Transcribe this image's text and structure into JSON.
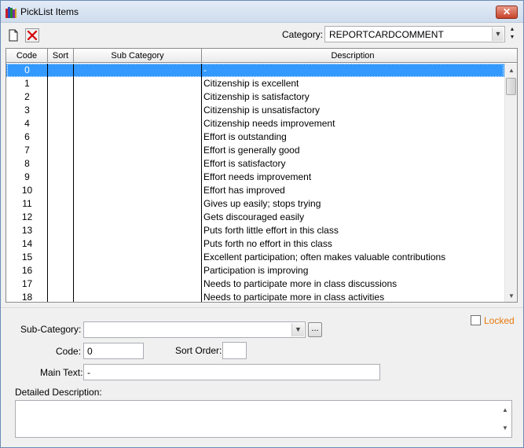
{
  "window": {
    "title": "PickList Items",
    "close_label": "✕"
  },
  "toolbar": {
    "category_label": "Category:",
    "category_value": "REPORTCARDCOMMENT"
  },
  "grid": {
    "columns": [
      "Code",
      "Sort",
      "Sub Category",
      "Description"
    ],
    "rows": [
      {
        "code": "0",
        "sort": "",
        "sub": "",
        "desc": "-"
      },
      {
        "code": "1",
        "sort": "",
        "sub": "",
        "desc": "Citizenship is excellent"
      },
      {
        "code": "2",
        "sort": "",
        "sub": "",
        "desc": "Citizenship is satisfactory"
      },
      {
        "code": "3",
        "sort": "",
        "sub": "",
        "desc": "Citizenship is unsatisfactory"
      },
      {
        "code": "4",
        "sort": "",
        "sub": "",
        "desc": "Citizenship needs improvement"
      },
      {
        "code": "6",
        "sort": "",
        "sub": "",
        "desc": "Effort is outstanding"
      },
      {
        "code": "7",
        "sort": "",
        "sub": "",
        "desc": "Effort is generally good"
      },
      {
        "code": "8",
        "sort": "",
        "sub": "",
        "desc": "Effort is satisfactory"
      },
      {
        "code": "9",
        "sort": "",
        "sub": "",
        "desc": "Effort needs improvement"
      },
      {
        "code": "10",
        "sort": "",
        "sub": "",
        "desc": "Effort has improved"
      },
      {
        "code": "11",
        "sort": "",
        "sub": "",
        "desc": "Gives up easily; stops trying"
      },
      {
        "code": "12",
        "sort": "",
        "sub": "",
        "desc": "Gets discouraged easily"
      },
      {
        "code": "13",
        "sort": "",
        "sub": "",
        "desc": "Puts forth little effort in this class"
      },
      {
        "code": "14",
        "sort": "",
        "sub": "",
        "desc": "Puts forth no effort in this class"
      },
      {
        "code": "15",
        "sort": "",
        "sub": "",
        "desc": "Excellent participation; often makes valuable contributions"
      },
      {
        "code": "16",
        "sort": "",
        "sub": "",
        "desc": "Participation is improving"
      },
      {
        "code": "17",
        "sort": "",
        "sub": "",
        "desc": "Needs to participate more in class discussions"
      },
      {
        "code": "18",
        "sort": "",
        "sub": "",
        "desc": "Needs to participate more in class activities"
      }
    ],
    "selected_index": 0
  },
  "form": {
    "locked_label": "Locked",
    "sub_category_label": "Sub-Category:",
    "sub_category_value": "",
    "ellipsis_label": "...",
    "code_label": "Code:",
    "code_value": "0",
    "sort_order_label": "Sort Order:",
    "sort_order_value": "",
    "main_text_label": "Main Text:",
    "main_text_value": "-",
    "detailed_description_label": "Detailed Description:",
    "detailed_description_value": ""
  },
  "colors": {
    "selection": "#3399ff",
    "locked_text": "#e8780c",
    "delete_icon": "#d40000"
  }
}
